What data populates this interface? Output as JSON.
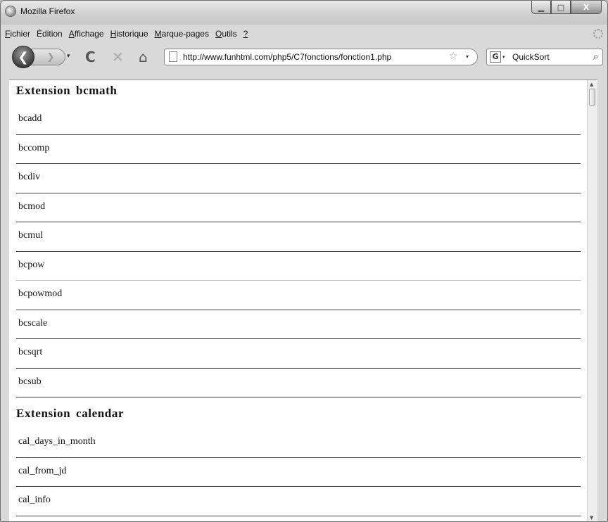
{
  "window": {
    "title": "Mozilla Firefox",
    "controls": {
      "minimize": "▁",
      "maximize": "□",
      "close": "X"
    }
  },
  "menubar": {
    "items": [
      {
        "accel": "F",
        "rest": "ichier"
      },
      {
        "accel": "",
        "rest": "Édition"
      },
      {
        "accel": "A",
        "rest": "ffichage"
      },
      {
        "accel": "H",
        "rest": "istorique"
      },
      {
        "accel": "M",
        "rest": "arque-pages"
      },
      {
        "accel": "O",
        "rest": "utils"
      },
      {
        "accel": "?",
        "rest": ""
      }
    ]
  },
  "navbar": {
    "back_glyph": "❮",
    "forward_glyph": "❯",
    "dropdown_glyph": "▾",
    "reload_glyph": "C",
    "stop_glyph": "✕",
    "home_glyph": "⌂",
    "url": "http://www.funhtml.com/php5/C7fonctions/fonction1.php",
    "bookmark_star": "☆",
    "search_engine_glyph": "G",
    "search_query": "QuickSort",
    "search_glyph": "⌕",
    "icons": {
      "back": "back-arrow-icon",
      "forward": "forward-arrow-icon",
      "reload": "reload-icon",
      "stop": "stop-icon",
      "home": "home-icon",
      "page": "page-icon",
      "star": "star-icon",
      "search": "magnifier-icon",
      "engine": "google-icon"
    }
  },
  "page": {
    "sections": [
      {
        "heading": "Extension  bcmath",
        "functions": [
          "bcadd",
          "bccomp",
          "bcdiv",
          "bcmod",
          "bcmul",
          "bcpow",
          "bcpowmod",
          "bcscale",
          "bcsqrt",
          "bcsub"
        ]
      },
      {
        "heading": "Extension  calendar",
        "functions": [
          "cal_days_in_month",
          "cal_from_jd",
          "cal_info"
        ]
      }
    ]
  },
  "scrollbar": {
    "up_glyph": "▲",
    "down_glyph": "▼"
  }
}
